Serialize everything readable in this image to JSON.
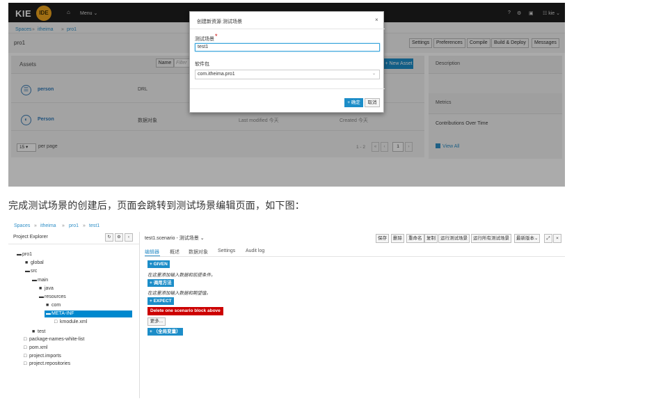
{
  "top_screenshot": {
    "logo": {
      "kie": "KIE",
      "ide": "IDE"
    },
    "nav": {
      "menu": "Menu",
      "help": "?",
      "user": "kie"
    },
    "breadcrumbs": [
      "Spaces",
      "itheima",
      "pro1"
    ],
    "project_title": "pro1",
    "toolbar": [
      "Settings",
      "Preferences",
      "Compile",
      "Build & Deploy",
      "Messages"
    ],
    "assets": {
      "title": "Assets",
      "sort_label": "Name",
      "filter_placeholder": "Filter",
      "new_asset": "+ New Asset",
      "rows": [
        {
          "name": "person",
          "type": "DRL",
          "modified": "",
          "created": ""
        },
        {
          "name": "Person",
          "type": "数据对象",
          "modified": "Last modified 今天",
          "created": "Created 今天"
        }
      ],
      "per_page_value": "15",
      "per_page_label": "per page",
      "page_range": "1 - 2",
      "page_number": "1"
    },
    "right_panel": {
      "description": "Description",
      "metrics": "Metrics",
      "contributions": "Contributions Over Time",
      "view_all": "View All"
    },
    "modal": {
      "title": "创建新资源 测试场景",
      "close": "×",
      "scenario_label": "测试场景",
      "required_mark": "*",
      "scenario_value": "test1",
      "package_label": "软件包",
      "package_value": "com.itheima.pro1",
      "ok": "+ 确定",
      "cancel": "取消"
    }
  },
  "caption": "完成测试场景的创建后，页面会跳转到测试场景编辑页面，如下图：",
  "bottom_screenshot": {
    "breadcrumbs": [
      "Spaces",
      "itheima",
      "pro1",
      "test1"
    ],
    "explorer_title": "Project Explorer",
    "tree": [
      {
        "label": "pro1",
        "icon": "folder-open"
      },
      {
        "label": "global",
        "icon": "folder"
      },
      {
        "label": "src",
        "icon": "folder-open"
      },
      {
        "label": "main",
        "icon": "folder-open"
      },
      {
        "label": "java",
        "icon": "folder"
      },
      {
        "label": "resources",
        "icon": "folder-open"
      },
      {
        "label": "com",
        "icon": "folder"
      },
      {
        "label": "META-INF",
        "icon": "folder-open"
      },
      {
        "label": "kmodule.xml",
        "icon": "file"
      },
      {
        "label": "test",
        "icon": "folder"
      },
      {
        "label": "package-names-white-list",
        "icon": "file"
      },
      {
        "label": "pom.xml",
        "icon": "file"
      },
      {
        "label": "project.imports",
        "icon": "file"
      },
      {
        "label": "project.repositories",
        "icon": "file"
      }
    ],
    "editor_title": "test1.scenario - 测试场景",
    "editor_toolbar": [
      "保存",
      "删除",
      "重命名",
      "复制",
      "运行测试场景",
      "运行所有测试场景",
      "最新版本"
    ],
    "tabs": [
      "编辑器",
      "概述",
      "数据对象",
      "Settings",
      "Audit log"
    ],
    "given_btn": "+ GIVEN",
    "given_hint": "在这里添加输入数据和前提条件。",
    "call_method_btn": "+ 调用方法",
    "call_hint": "在这里添加输入数据和期望值。",
    "expect_btn": "+ EXPECT",
    "delete_bar": "Delete one scenario block above",
    "more_btn": "更多...",
    "global_btn": "+ （全局变量）"
  }
}
